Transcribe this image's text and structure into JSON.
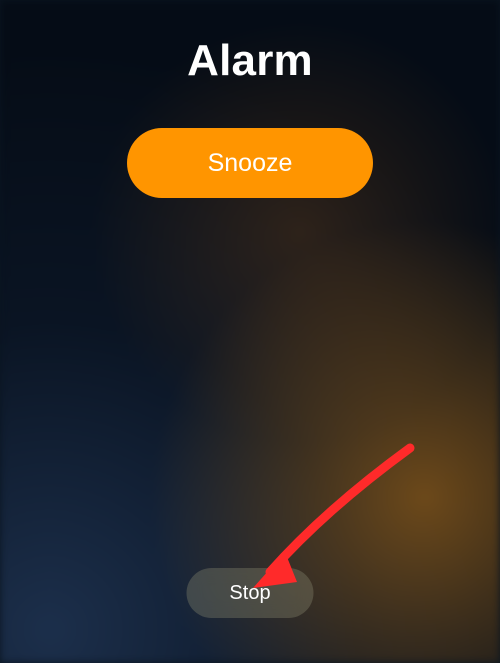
{
  "alarm": {
    "title": "Alarm",
    "snooze_label": "Snooze",
    "stop_label": "Stop"
  }
}
